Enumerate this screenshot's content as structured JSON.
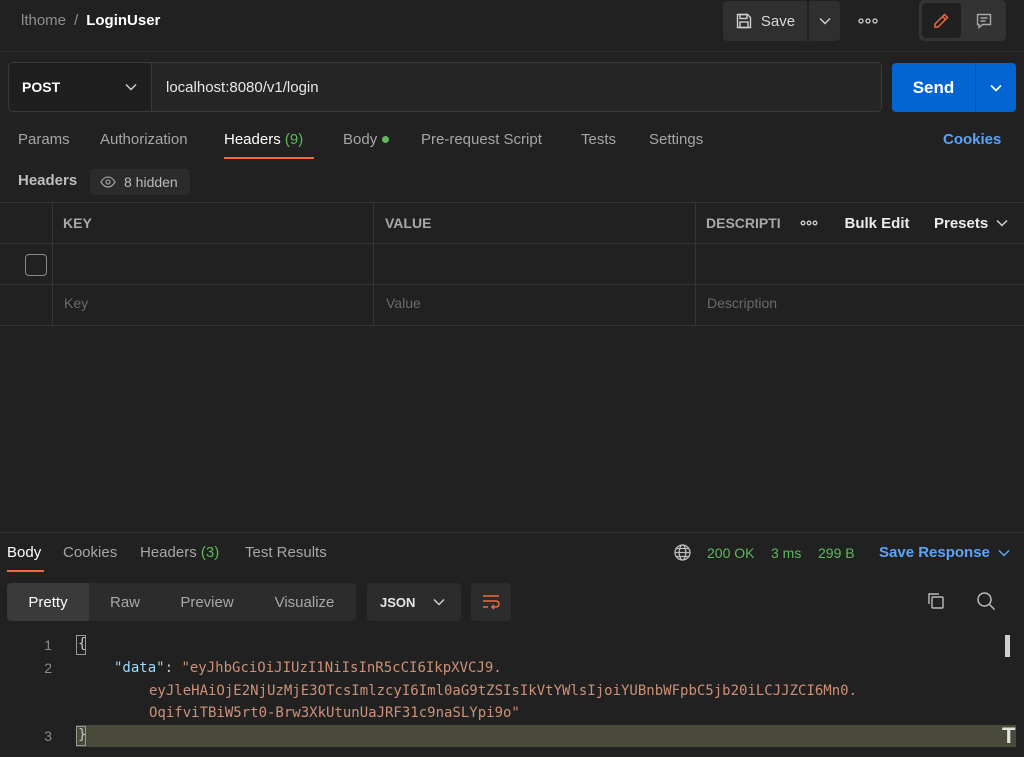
{
  "breadcrumb": {
    "workspace": "lthome",
    "separator": "/",
    "request": "LoginUser"
  },
  "toolbar": {
    "save_label": "Save",
    "more_icon": "more-horizontal-icon",
    "edit_icon": "pencil-icon",
    "comment_icon": "comment-icon"
  },
  "request": {
    "method": "POST",
    "url": "localhost:8080/v1/login",
    "send_label": "Send"
  },
  "request_tabs": [
    {
      "label": "Params"
    },
    {
      "label": "Authorization"
    },
    {
      "label": "Headers",
      "count": "(9)"
    },
    {
      "label": "Body"
    },
    {
      "label": "Pre-request Script"
    },
    {
      "label": "Tests"
    },
    {
      "label": "Settings"
    }
  ],
  "cookies_label": "Cookies",
  "headers_section": {
    "label": "Headers",
    "hidden_label": "8 hidden",
    "columns": [
      "KEY",
      "VALUE",
      "DESCRIPTI"
    ],
    "bulk_edit": "Bulk Edit",
    "presets": "Presets",
    "placeholders": {
      "key": "Key",
      "value": "Value",
      "description": "Description"
    }
  },
  "response_tabs": [
    {
      "label": "Body"
    },
    {
      "label": "Cookies"
    },
    {
      "label": "Headers",
      "count": "(3)"
    },
    {
      "label": "Test Results"
    }
  ],
  "response_status": {
    "status": "200 OK",
    "time": "3 ms",
    "size": "299 B",
    "save_response": "Save Response"
  },
  "format_tabs": [
    "Pretty",
    "Raw",
    "Preview",
    "Visualize"
  ],
  "language": "JSON",
  "code": {
    "line_numbers": [
      "1",
      "2",
      "3"
    ],
    "open_brace": "{",
    "key": "\"data\"",
    "colon": ": ",
    "value_line1": "\"eyJhbGciOiJIUzI1NiIsInR5cCI6IkpXVCJ9.",
    "value_line2": "eyJleHAiOjE2NjUzMjE3OTcsImlzcyI6Iml0aG9tZSIsIkVtYWlsIjoiYUBnbWFpbC5jb20iLCJJZCI6Mn0.",
    "value_line3": "OqifviTBiW5rt0-Brw3XkUtunUaJRF31c9naSLYpi9o\"",
    "close_brace": "}"
  },
  "colors": {
    "accent": "#f06a3b",
    "send": "#0265d2",
    "success": "#5cb85c",
    "link": "#5ba4f7"
  }
}
